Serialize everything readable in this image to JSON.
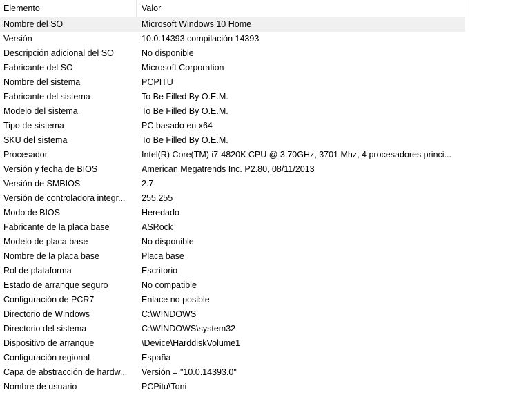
{
  "columns": {
    "element": "Elemento",
    "value": "Valor"
  },
  "rows": [
    {
      "name": "Nombre del SO",
      "value": "Microsoft Windows 10 Home",
      "selected": true
    },
    {
      "name": "Versión",
      "value": "10.0.14393 compilación 14393"
    },
    {
      "name": "Descripción adicional del SO",
      "value": "No disponible"
    },
    {
      "name": "Fabricante del SO",
      "value": "Microsoft Corporation"
    },
    {
      "name": "Nombre del sistema",
      "value": "PCPITU"
    },
    {
      "name": "Fabricante del sistema",
      "value": "To Be Filled By O.E.M."
    },
    {
      "name": "Modelo del sistema",
      "value": "To Be Filled By O.E.M."
    },
    {
      "name": "Tipo de sistema",
      "value": "PC basado en x64"
    },
    {
      "name": "SKU del sistema",
      "value": "To Be Filled By O.E.M."
    },
    {
      "name": "Procesador",
      "value": "Intel(R) Core(TM) i7-4820K CPU @ 3.70GHz, 3701 Mhz, 4 procesadores princi..."
    },
    {
      "name": "Versión y fecha de BIOS",
      "value": "American Megatrends Inc. P2.80, 08/11/2013"
    },
    {
      "name": "Versión de SMBIOS",
      "value": "2.7"
    },
    {
      "name": "Versión de controladora integr...",
      "value": "255.255"
    },
    {
      "name": "Modo de BIOS",
      "value": "Heredado"
    },
    {
      "name": "Fabricante de la placa base",
      "value": "ASRock"
    },
    {
      "name": "Modelo de placa base",
      "value": "No disponible"
    },
    {
      "name": "Nombre de la placa base",
      "value": "Placa base"
    },
    {
      "name": "Rol de plataforma",
      "value": "Escritorio"
    },
    {
      "name": "Estado de arranque seguro",
      "value": "No compatible"
    },
    {
      "name": "Configuración de PCR7",
      "value": "Enlace no posible"
    },
    {
      "name": "Directorio de Windows",
      "value": "C:\\WINDOWS"
    },
    {
      "name": "Directorio del sistema",
      "value": "C:\\WINDOWS\\system32"
    },
    {
      "name": "Dispositivo de arranque",
      "value": "\\Device\\HarddiskVolume1"
    },
    {
      "name": "Configuración regional",
      "value": "España"
    },
    {
      "name": "Capa de abstracción de hardw...",
      "value": "Versión = \"10.0.14393.0\""
    },
    {
      "name": "Nombre de usuario",
      "value": "PCPitu\\Toni"
    }
  ]
}
